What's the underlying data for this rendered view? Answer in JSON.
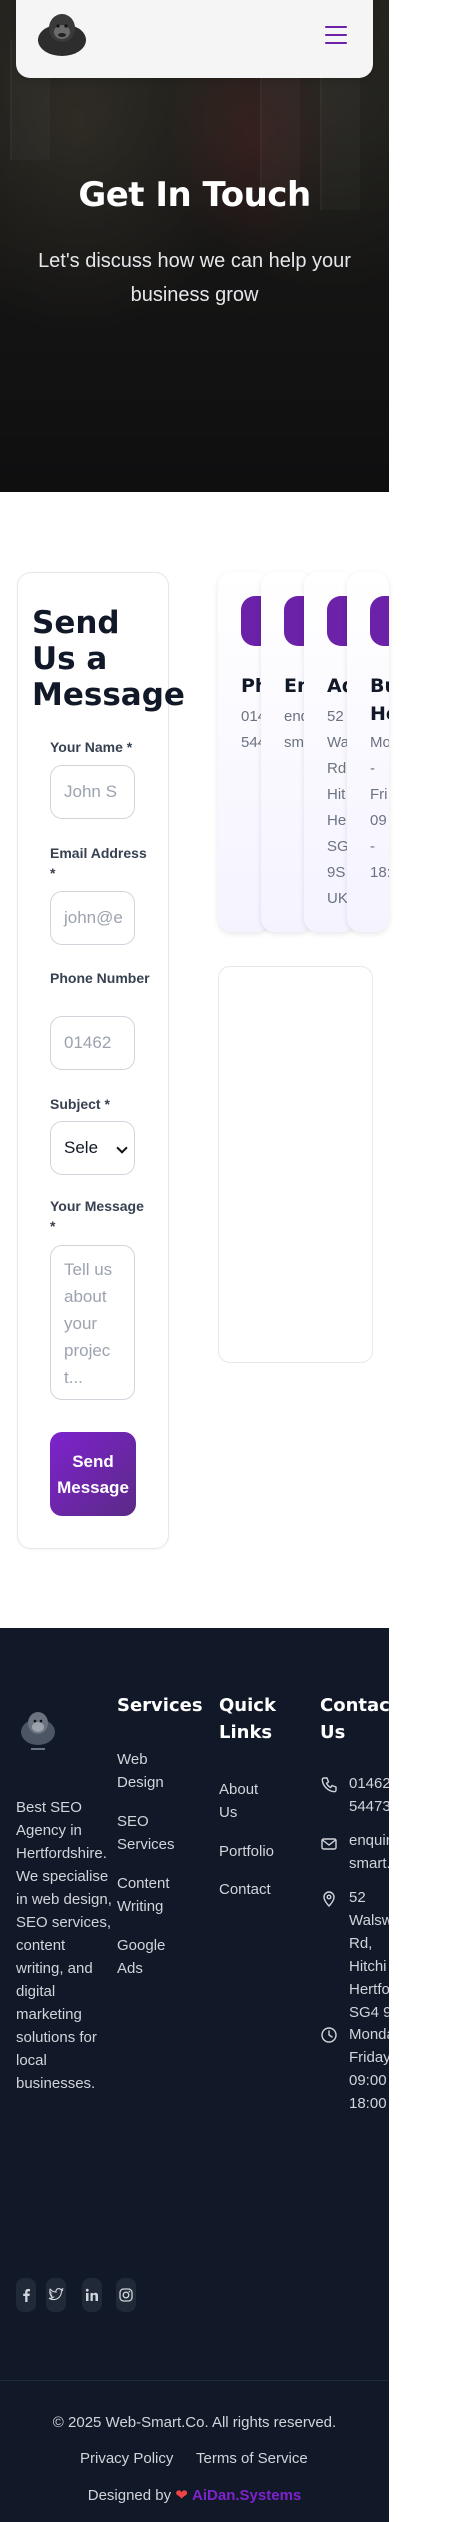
{
  "hero": {
    "title": "Get In Touch",
    "subtitle": "Let's discuss how we can help your business grow"
  },
  "nav": {
    "logo_icon": "gorilla-logo-icon",
    "menu_icon": "hamburger-menu-icon",
    "accent": "#6b21a8"
  },
  "form": {
    "title": "Send Us a Message",
    "name_label": "Your Name *",
    "name_placeholder": "John S",
    "email_label": "Email Address *",
    "email_placeholder": "john@e",
    "phone_label": "Phone Number",
    "phone_placeholder": "01462",
    "subject_label": "Subject *",
    "subject_value": "Sele",
    "message_label": "Your Message *",
    "message_placeholder": "Tell us about your projec t...",
    "submit_label": "Send Message"
  },
  "info_cards": [
    {
      "title": "Ph",
      "value": "014\n544"
    },
    {
      "title": "En",
      "value": "enq\nsm"
    },
    {
      "title": "Ad",
      "value": "52\nWa\nRd\nHit\nHe\nSG\n9S\nUK"
    },
    {
      "title": "Bu\nHo",
      "value": "Mo\n-\nFri\n09\n-\n18:"
    }
  ],
  "footer": {
    "description": "Best SEO Agency in Hertfordshire. We specialise in web design, SEO services, content writing, and digital marketing solutions for local businesses.",
    "services_heading": "Services",
    "services": [
      "Web Design",
      "SEO Services",
      "Content Writing",
      "Google Ads"
    ],
    "quick_heading": "Quick Links",
    "quick_links": [
      "About Us",
      "Portfolio",
      "Contact"
    ],
    "contact_heading": "Contact Us",
    "contact": {
      "phone": "01462\n54473",
      "email": "enquir\nsmart.",
      "address": "52\nWalsw\nRd,\nHitchi\nHertfo\nSG4 9",
      "hours": "Monda\nFriday\n09:00\n18:00"
    },
    "copyright": "© 2025 Web-Smart.Co. All rights reserved.",
    "privacy": "Privacy Policy",
    "terms": "Terms of Service",
    "designed_by": "Designed by",
    "designed_brand": "AiDan.Systems"
  }
}
